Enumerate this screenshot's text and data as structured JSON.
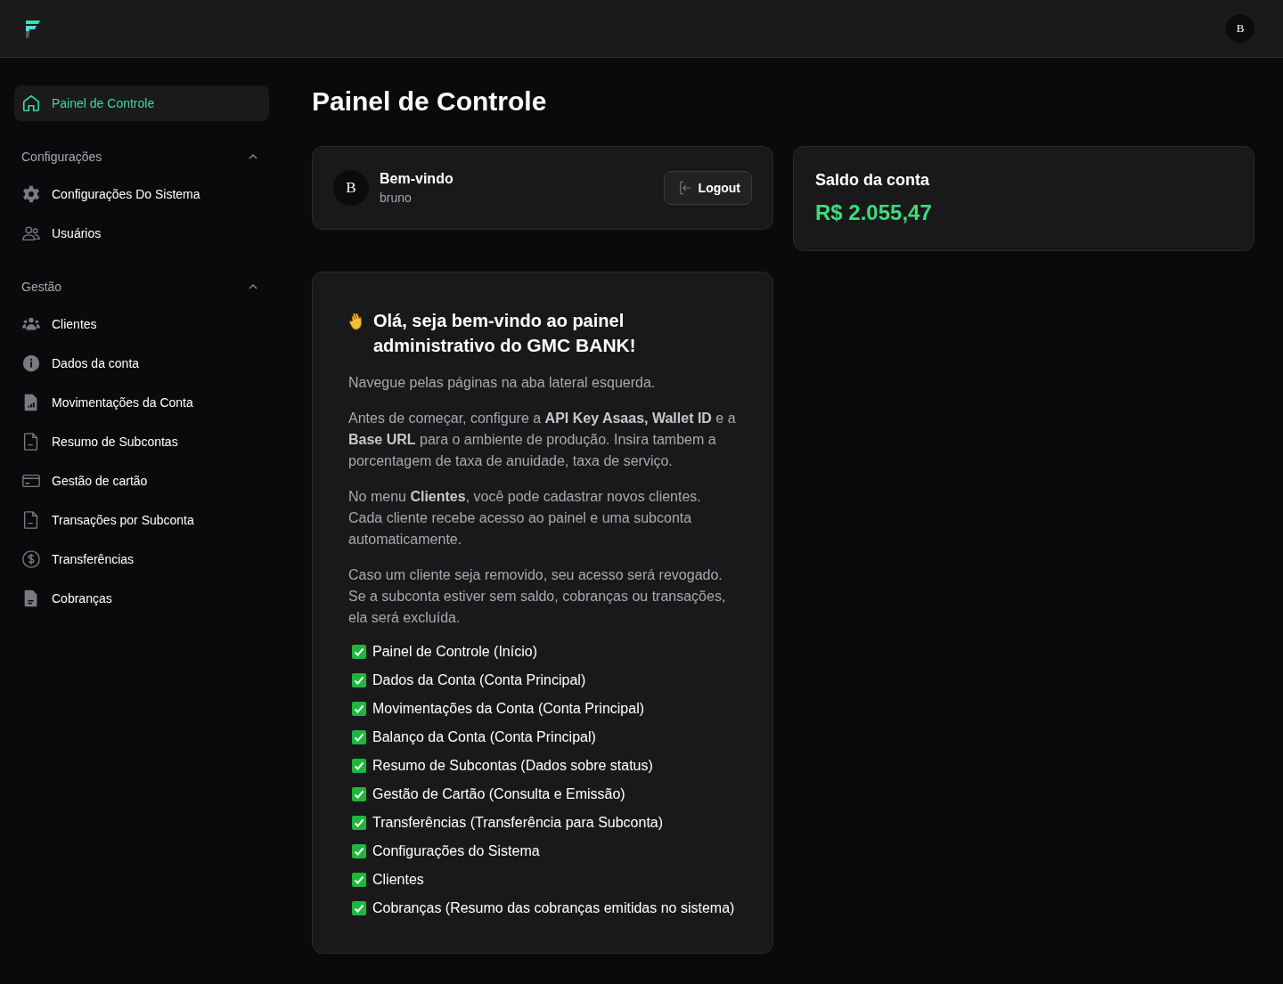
{
  "topbar": {
    "avatar": "B"
  },
  "sidebar": {
    "home": {
      "label": "Painel de Controle",
      "kind": "home",
      "selected": true
    },
    "sections": [
      {
        "title": "Configurações",
        "expanded": true,
        "items": [
          {
            "label": "Configurações Do Sistema",
            "kind": "gear",
            "selected": false
          },
          {
            "label": "Usuários",
            "kind": "users",
            "selected": false
          }
        ]
      },
      {
        "title": "Gestão",
        "expanded": true,
        "items": [
          {
            "label": "Clientes",
            "kind": "group",
            "selected": false
          },
          {
            "label": "Dados da conta",
            "kind": "info",
            "selected": false
          },
          {
            "label": "Movimentações da Conta",
            "kind": "chartfile",
            "selected": false
          },
          {
            "label": "Resumo de Subcontas",
            "kind": "file",
            "selected": false
          },
          {
            "label": "Gestão de cartão",
            "kind": "card",
            "selected": false
          },
          {
            "label": "Transações por Subconta",
            "kind": "file",
            "selected": false
          },
          {
            "label": "Transferências",
            "kind": "dollar",
            "selected": false
          },
          {
            "label": "Cobranças",
            "kind": "filledfile",
            "selected": false
          }
        ]
      }
    ]
  },
  "page": {
    "title": "Painel de Controle",
    "user_card": {
      "avatar": "B",
      "greeting": "Bem-vindo",
      "username": "bruno",
      "button": "Logout"
    },
    "balance_card": {
      "title": "Saldo da conta",
      "amount": "R$ 2.055,47"
    },
    "intro": {
      "heading": "Olá, seja bem-vindo ao painel administrativo do **GMC BANK**!",
      "paragraphs": [
        "Navegue pelas páginas na aba lateral esquerda.",
        "Antes de começar, configure a **API Key Asaas, Wallet ID** e a **Base URL** para o ambiente de produção. Insira tambem a porcentagem de taxa de anuidade, taxa de serviço.",
        "No menu **Clientes**, você pode cadastrar novos clientes. Cada cliente recebe acesso ao painel e uma subconta automaticamente.",
        "Caso um cliente seja removido, seu acesso será revogado. Se a subconta estiver sem saldo, cobranças ou transações, ela será excluída."
      ],
      "checklist": [
        {
          "label": "Painel de Controle (Início)",
          "checked": true
        },
        {
          "label": "Dados da Conta (Conta Principal)",
          "checked": true
        },
        {
          "label": "Movimentações da Conta (Conta Principal)",
          "checked": true
        },
        {
          "label": "Balanço da Conta (Conta Principal)",
          "checked": true
        },
        {
          "label": "Resumo de Subcontas (Dados sobre status)",
          "checked": true
        },
        {
          "label": "Gestão de Cartão (Consulta e Emissão)",
          "checked": true
        },
        {
          "label": "Transferências (Transferência para Subconta)",
          "checked": true
        },
        {
          "label": "Configurações do Sistema",
          "checked": true
        },
        {
          "label": "Clientes",
          "checked": true
        },
        {
          "label": "Cobranças (Resumo das cobranças emitidas no sistema)",
          "checked": true
        }
      ]
    }
  }
}
